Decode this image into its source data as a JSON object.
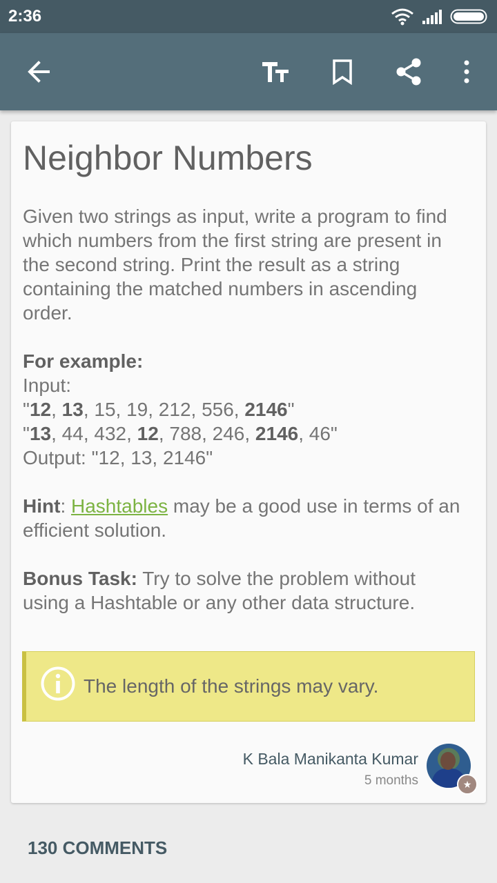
{
  "status": {
    "time": "2:36"
  },
  "appbar": {
    "icons": [
      "back-arrow-icon",
      "text-size-icon",
      "bookmark-icon",
      "share-icon",
      "more-vert-icon"
    ]
  },
  "post": {
    "title": "Neighbor Numbers",
    "intro": "Given two strings as input, write a program to find which numbers from the first string are present in the second string. Print the result as a string containing the matched numbers in ascending order.",
    "example": {
      "heading": "For example:",
      "input_label": "Input:",
      "line1": [
        {
          "t": "\"",
          "b": false
        },
        {
          "t": "12",
          "b": true
        },
        {
          "t": ", ",
          "b": false
        },
        {
          "t": "13",
          "b": true
        },
        {
          "t": ", 15, 19, 212, 556, ",
          "b": false
        },
        {
          "t": "2146",
          "b": true
        },
        {
          "t": "\"",
          "b": false
        }
      ],
      "line2": [
        {
          "t": "\"",
          "b": false
        },
        {
          "t": "13",
          "b": true
        },
        {
          "t": ", 44, 432, ",
          "b": false
        },
        {
          "t": "12",
          "b": true
        },
        {
          "t": ", 788, 246, ",
          "b": false
        },
        {
          "t": "2146",
          "b": true
        },
        {
          "t": ", 46\"",
          "b": false
        }
      ],
      "output": "Output: \"12, 13, 2146\""
    },
    "hint": {
      "label": "Hint",
      "colon": ": ",
      "link": "Hashtables",
      "rest": " may be a good use in terms of an efficient solution."
    },
    "bonus": {
      "label": "Bonus Task:",
      "text": " Try to solve the problem without using a Hashtable or any other data structure."
    },
    "note": "The length of the strings may vary.",
    "author": {
      "name": "K Bala Manikanta Kumar",
      "time": "5 months"
    }
  },
  "comments_label": "130 COMMENTS",
  "colors": {
    "statusbar": "#455a64",
    "appbar": "#546e7a",
    "link": "#7cb342",
    "note_bg": "#eee888"
  }
}
